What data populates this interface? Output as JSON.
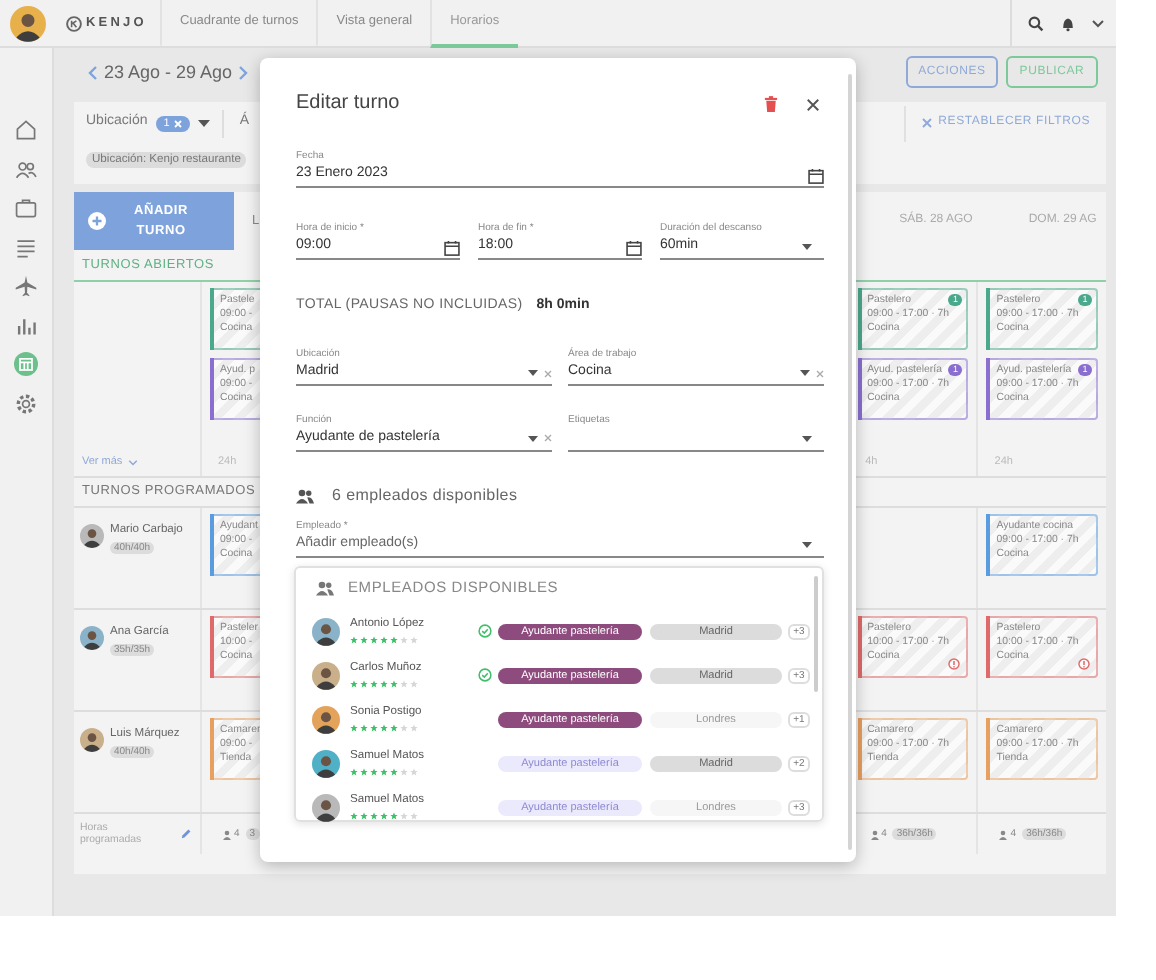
{
  "app_bar": {
    "logo": "KENJO",
    "tabs": [
      {
        "label": "Cuadrante de turnos",
        "selected": false
      },
      {
        "label": "Vista general",
        "selected": false
      },
      {
        "label": "Horarios",
        "selected": true
      }
    ]
  },
  "sidebar": {
    "items": [
      {
        "kind": "home",
        "selected": false
      },
      {
        "kind": "people",
        "selected": false
      },
      {
        "kind": "briefcase",
        "selected": false
      },
      {
        "kind": "list",
        "selected": false
      },
      {
        "kind": "plane",
        "selected": false
      },
      {
        "kind": "chart",
        "selected": false
      },
      {
        "kind": "calendar",
        "selected": true
      },
      {
        "kind": "gear",
        "selected": false
      }
    ]
  },
  "toolbar": {
    "date_range": "23 Ago - 29 Ago",
    "buttons": [
      {
        "label": "ACCIONES",
        "kind": "secondary"
      },
      {
        "label": "PUBLICAR",
        "kind": "primary"
      }
    ]
  },
  "filters": {
    "dropdowns": [
      {
        "label": "Ubicación",
        "count": "1"
      },
      {
        "label": "Á"
      }
    ],
    "reset": "RESTABLECER FILTROS",
    "chips": [
      "Ubicación: Kenjo restaurante"
    ]
  },
  "schedule": {
    "add_button": "AÑADIR TURNO",
    "days": [
      "L",
      "SÁB. 28 AGO",
      "DOM. 29 AG"
    ],
    "open_title": "TURNOS ABIERTOS",
    "open_shifts": [
      [
        {
          "role": "Pastele",
          "time": "09:00 -",
          "area": "Cocina",
          "color": "#4aa88c"
        },
        {
          "role": "Ayud. p",
          "time": "09:00 -",
          "area": "Cocina",
          "color": "#8a6fd0"
        }
      ],
      [
        {
          "role": "Pastelero",
          "time": "09:00 - 17:00 · 7h",
          "area": "Cocina",
          "color": "#4aa88c",
          "badge": "1",
          "alert": false
        },
        {
          "role": "Ayud. pastelería",
          "time": "09:00 - 17:00 · 7h",
          "area": "Cocina",
          "color": "#8a6fd0",
          "badge": "1",
          "alert": false
        }
      ],
      [
        {
          "role": "Pastelero",
          "time": "09:00 - 17:00 · 7h",
          "area": "Cocina",
          "color": "#4aa88c",
          "badge": "1",
          "alert": false
        },
        {
          "role": "Ayud. pastelería",
          "time": "09:00 - 17:00 · 7h",
          "area": "Cocina",
          "color": "#8a6fd0",
          "badge": "1",
          "alert": false
        }
      ]
    ],
    "see_more": "Ver más",
    "open_totals": [
      "24h",
      "4h",
      "24h"
    ],
    "scheduled_title": "TURNOS PROGRAMADOS",
    "employees": [
      {
        "name": "Mario Carbajo",
        "hours": "40h/40h",
        "shifts": {
          "monday": {
            "role": "Ayudant",
            "time": "09:00 -",
            "area": "Cocina",
            "color": "#5b9be0"
          },
          "sunday": {
            "role": "Ayudante cocina",
            "time": "09:00 - 17:00 · 7h",
            "area": "Cocina",
            "color": "#5b9be0",
            "alert": false
          }
        }
      },
      {
        "name": "Ana García",
        "hours": "35h/35h",
        "shifts": {
          "monday": {
            "role": "Pasteler",
            "time": "10:00 -",
            "area": "Cocina",
            "color": "#e06a6a"
          },
          "saturday": {
            "role": "Pastelero",
            "time": "10:00 - 17:00 · 7h",
            "area": "Cocina",
            "color": "#e06a6a",
            "alert": true
          },
          "sunday": {
            "role": "Pastelero",
            "time": "10:00 - 17:00 · 7h",
            "area": "Cocina",
            "color": "#e06a6a",
            "alert": true
          }
        }
      },
      {
        "name": "Luis Márquez",
        "hours": "40h/40h",
        "shifts": {
          "monday": {
            "role": "Camarer",
            "time": "09:00 -",
            "area": "Tienda",
            "color": "#e8a060"
          },
          "saturday": {
            "role": "Camarero",
            "time": "09:00 - 17:00 · 7h",
            "area": "Tienda",
            "color": "#e8a060",
            "alert": false
          },
          "sunday": {
            "role": "Camarero",
            "time": "09:00 - 17:00 · 7h",
            "area": "Tienda",
            "color": "#e8a060",
            "alert": false
          }
        }
      }
    ],
    "footer": {
      "label": "Horas programadas",
      "totals": [
        {
          "count": "4",
          "hours": "3"
        },
        {
          "count": "4",
          "hours": "36h/36h"
        },
        {
          "count": "4",
          "hours": "36h/36h"
        }
      ]
    }
  },
  "modal": {
    "title": "Editar turno",
    "rows": [
      {
        "kind": "fields",
        "fields": [
          {
            "kind": "date",
            "label": "Fecha",
            "value": "23 Enero 2023"
          }
        ]
      },
      {
        "kind": "fields",
        "fields": [
          {
            "kind": "date",
            "label": "Hora de inicio *",
            "value": "09:00"
          },
          {
            "kind": "date",
            "label": "Hora de fin *",
            "value": "18:00"
          },
          {
            "kind": "select",
            "label": "Duración del descanso",
            "value": "60min"
          }
        ]
      },
      {
        "kind": "total",
        "label": "TOTAL (PAUSAS NO INCLUIDAS)",
        "value": "8h 0min"
      },
      {
        "kind": "fields",
        "fields": [
          {
            "kind": "clearable",
            "label": "Ubicación",
            "value": "Madrid"
          },
          {
            "kind": "clearable",
            "label": "Área de trabajo",
            "value": "Cocina"
          }
        ]
      },
      {
        "kind": "fields",
        "fields": [
          {
            "kind": "clearable",
            "label": "Función",
            "value": "Ayudante de pastelería"
          },
          {
            "kind": "select",
            "label": "Etiquetas"
          }
        ]
      },
      {
        "kind": "heading",
        "text": "6 empleados disponibles"
      },
      {
        "kind": "fields",
        "fields": [
          {
            "kind": "select",
            "label": "Empleado *",
            "placeholder": "Añadir empleado(s)"
          }
        ]
      }
    ],
    "dropdown": {
      "title": "EMPLEADOS DISPONIBLES",
      "employees": [
        {
          "name": "Antonio López",
          "stars": 5,
          "checked": true,
          "function": {
            "text": "Ayudante pastelería",
            "disabled": false
          },
          "location": {
            "text": "Madrid",
            "disabled": false
          },
          "more": "+3"
        },
        {
          "name": "Carlos Muñoz",
          "stars": 5,
          "checked": true,
          "function": {
            "text": "Ayudante pastelería",
            "disabled": false
          },
          "location": {
            "text": "Madrid",
            "disabled": false
          },
          "more": "+3"
        },
        {
          "name": "Sonia Postigo",
          "stars": 5,
          "checked": false,
          "function": {
            "text": "Ayudante pastelería",
            "disabled": false
          },
          "location": {
            "text": "Londres",
            "disabled": true
          },
          "more": "+1"
        },
        {
          "name": "Samuel Matos",
          "stars": 5,
          "checked": false,
          "function": {
            "text": "Ayudante pastelería",
            "disabled": true
          },
          "location": {
            "text": "Madrid",
            "disabled": false
          },
          "more": "+2"
        },
        {
          "name": "Samuel Matos",
          "stars": 5,
          "checked": false,
          "function": {
            "text": "Ayudante pastelería",
            "disabled": true
          },
          "location": {
            "text": "Londres",
            "disabled": true
          },
          "more": "+3"
        }
      ]
    }
  }
}
